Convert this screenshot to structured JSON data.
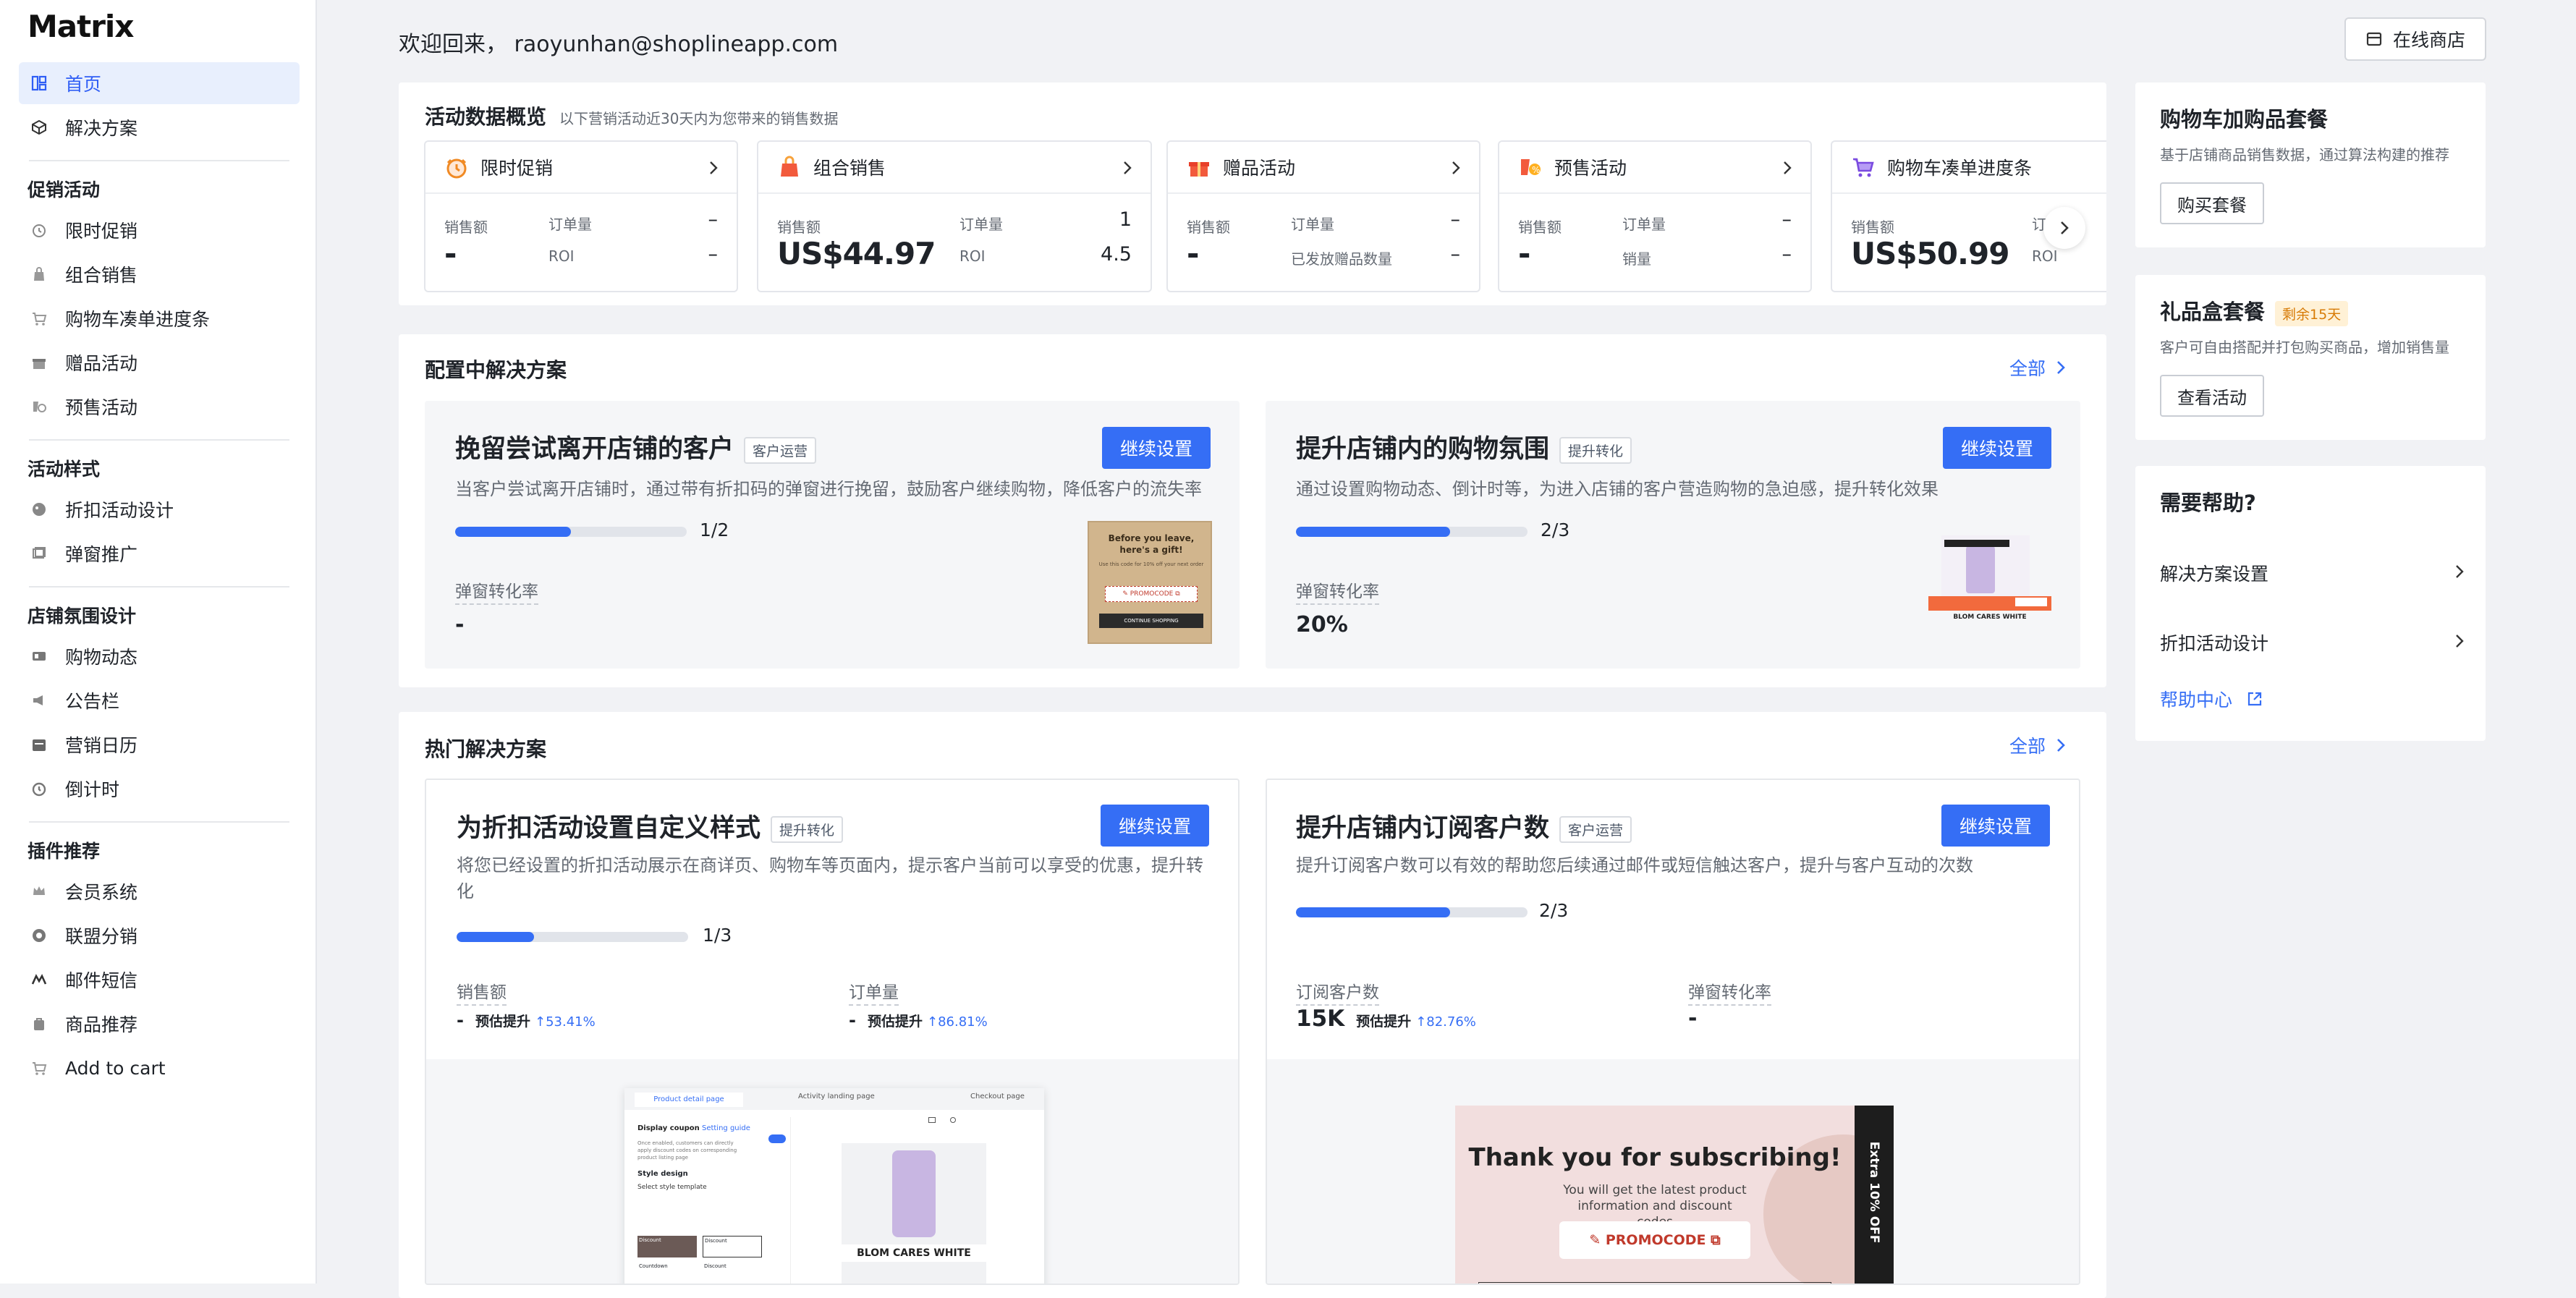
{
  "app": {
    "logo": "Matrix"
  },
  "sidebar": {
    "home": "首页",
    "solutions": "解决方案",
    "promo_section": "促销活动",
    "promo_items": [
      "限时促销",
      "组合销售",
      "购物车凑单进度条",
      "赠品活动",
      "预售活动"
    ],
    "style_section": "活动样式",
    "style_items": [
      "折扣活动设计",
      "弹窗推广"
    ],
    "atmos_section": "店铺氛围设计",
    "atmos_items": [
      "购物动态",
      "公告栏",
      "营销日历",
      "倒计时"
    ],
    "plugin_section": "插件推荐",
    "plugin_items": [
      "会员系统",
      "联盟分销",
      "邮件短信",
      "商品推荐",
      "Add to cart"
    ]
  },
  "header": {
    "welcome": "欢迎回来，  raoyunhan@shoplineapp.com",
    "store_button": "在线商店"
  },
  "overview": {
    "title": "活动数据概览",
    "subtitle": "以下营销活动近30天内为您带来的销售数据",
    "tiles": [
      {
        "name": "限时促销",
        "sales_label": "销售额",
        "sales": "-",
        "l1": "订单量",
        "v1": "–",
        "l2": "ROI",
        "v2": "–"
      },
      {
        "name": "组合销售",
        "sales_label": "销售额",
        "sales": "US$44.97",
        "l1": "订单量",
        "v1": "1",
        "l2": "ROI",
        "v2": "4.5"
      },
      {
        "name": "赠品活动",
        "sales_label": "销售额",
        "sales": "-",
        "l1": "订单量",
        "v1": "–",
        "l2": "已发放赠品数量",
        "v2": "–"
      },
      {
        "name": "预售活动",
        "sales_label": "销售额",
        "sales": "-",
        "l1": "订单量",
        "v1": "–",
        "l2": "销量",
        "v2": "–"
      },
      {
        "name": "购物车凑单进度条",
        "sales_label": "销售额",
        "sales": "US$50.99",
        "l1": "订",
        "v1": "",
        "l2": "ROI",
        "v2": ""
      }
    ]
  },
  "configuring": {
    "title": "配置中解决方案",
    "all_link": "全部",
    "cards": [
      {
        "title": "挽留尝试离开店铺的客户",
        "tag": "客户运营",
        "button": "继续设置",
        "desc": "当客户尝试离开店铺时，通过带有折扣码的弹窗进行挽留，鼓励客户继续购物，降低客户的流失率",
        "progress_text": "1/2",
        "progress": 0.5,
        "metric_label": "弹窗转化率",
        "metric_value": "-",
        "preview": {
          "heading": "Before you leave, here's a gift!",
          "line": "Use this code for 10% off your next order",
          "code": "PROMOCODE",
          "cta": "CONTINUE SHOPPING"
        }
      },
      {
        "title": "提升店铺内的购物氛围",
        "tag": "提升转化",
        "button": "继续设置",
        "desc": "通过设置购物动态、倒计时等，为进入店铺的客户营造购物的急迫感，提升转化效果",
        "progress_text": "2/3",
        "progress": 0.667,
        "metric_label": "弹窗转化率",
        "metric_value": "20%",
        "preview": {
          "brand": "BLOM CARES WHITE"
        }
      }
    ]
  },
  "popular": {
    "title": "热门解决方案",
    "all_link": "全部",
    "cards": [
      {
        "title": "为折扣活动设置自定义样式",
        "tag": "提升转化",
        "button": "继续设置",
        "desc": "将您已经设置的折扣活动展示在商详页、购物车等页面内，提示客户当前可以享受的优惠，提升转化",
        "progress_text": "1/3",
        "progress": 0.333,
        "m1_label": "销售额",
        "m1_value": "-",
        "m1_est": "预估提升",
        "m1_pct": "53.41%",
        "m2_label": "订单量",
        "m2_value": "-",
        "m2_est": "预估提升",
        "m2_pct": "86.81%",
        "preview": {
          "tabs": [
            "Product detail page",
            "Activity landing page",
            "Checkout page"
          ],
          "setting_title": "Display coupon",
          "guide": "Setting guide",
          "setting_desc": "Once enabled, customers can directly apply discount codes on corresponding product listing page",
          "style_design": "Style design",
          "select_template": "Select style template",
          "template_names": [
            "Discount",
            "Discount",
            "Countdown",
            "Discount"
          ],
          "brand": "BLOM CARES WHITE"
        }
      },
      {
        "title": "提升店铺内订阅客户数",
        "tag": "客户运营",
        "button": "继续设置",
        "desc": "提升订阅客户数可以有效的帮助您后续通过邮件或短信触达客户，提升与客户互动的次数",
        "progress_text": "2/3",
        "progress": 0.667,
        "m1_label": "订阅客户数",
        "m1_value": "15K",
        "m1_est": "预估提升",
        "m1_pct": "82.76%",
        "m2_label": "弹窗转化率",
        "m2_value": "-",
        "preview": {
          "heading": "Thank you for subscribing!",
          "line": "You will get the latest product information and discount codes",
          "code": "PROMOCODE",
          "side": "Extra 10% OFF"
        }
      }
    ]
  },
  "right": {
    "bundle": {
      "title": "购物车加购品套餐",
      "desc": "基于店铺商品销售数据，通过算法构建的推荐",
      "button": "购买套餐"
    },
    "giftbox": {
      "title": "礼品盒套餐",
      "badge": "剩余15天",
      "desc": "客户可自由搭配并打包购买商品，增加销售量",
      "button": "查看活动"
    },
    "help": {
      "title": "需要帮助?",
      "items": [
        "解决方案设置",
        "折扣活动设计"
      ],
      "center": "帮助中心"
    }
  },
  "colors": {
    "primary": "#356ef5",
    "bg": "#f1f2f5",
    "active_bg": "#e8effd"
  }
}
